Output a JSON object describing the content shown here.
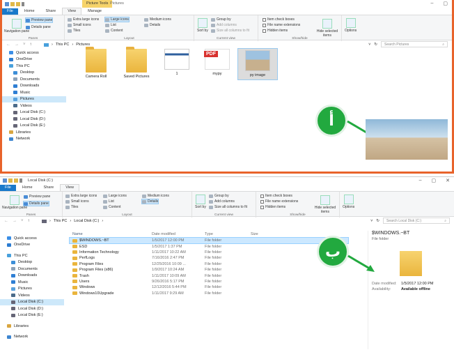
{
  "window1": {
    "context_tab": "Picture Tools",
    "title": "Pictures",
    "tabs": [
      "File",
      "Home",
      "Share",
      "View",
      "Manage"
    ],
    "ribbon": {
      "pane": {
        "navigation_pane": "Navigation pane",
        "preview_pane": "Preview pane",
        "details_pane": "Details pane",
        "label": "Panes"
      },
      "layout": {
        "extra_large": "Extra large icons",
        "large": "Large icons",
        "medium": "Medium icons",
        "small": "Small icons",
        "list": "List",
        "details": "Details",
        "tiles": "Tiles",
        "content": "Content",
        "label": "Layout"
      },
      "current_view": {
        "sort_by": "Sort by",
        "group_by": "Group by",
        "add_columns": "Add columns",
        "size_all": "Size all columns to fit",
        "label": "Current view"
      },
      "show_hide": {
        "item_check": "Item check boxes",
        "file_ext": "File name extensions",
        "hidden": "Hidden items",
        "hide_selected": "Hide selected items",
        "label": "Show/hide"
      },
      "options": "Options"
    },
    "path": [
      "This PC",
      "Pictures"
    ],
    "search_placeholder": "Search Pictures",
    "nav": [
      "Quick access",
      "OneDrive",
      "This PC",
      "Desktop",
      "Documents",
      "Downloads",
      "Music",
      "Pictures",
      "Videos",
      "Local Disk (C:)",
      "Local Disk (D:)",
      "Local Disk (E:)",
      "Libraries",
      "Network"
    ],
    "items": [
      "Camera Roll",
      "Saved Pictures",
      "1",
      "mypy",
      "py image"
    ],
    "pdf_label": "PDF",
    "badge": "أ"
  },
  "window2": {
    "title": "Local Disk (C:)",
    "tabs": [
      "File",
      "Home",
      "Share",
      "View"
    ],
    "path": [
      "This PC",
      "Local Disk (C:)"
    ],
    "search_placeholder": "Search Local Disk (C:)",
    "nav": [
      "Quick access",
      "OneDrive",
      "This PC",
      "Desktop",
      "Documents",
      "Downloads",
      "Music",
      "Pictures",
      "Videos",
      "Local Disk (C:)",
      "Local Disk (D:)",
      "Local Disk (E:)",
      "Libraries",
      "Network"
    ],
    "columns": [
      "Name",
      "Date modified",
      "Type",
      "Size"
    ],
    "rows": [
      {
        "name": "$WINDOWS.~BT",
        "date": "1/5/2017 12:00 PM",
        "type": "File folder"
      },
      {
        "name": "ESD",
        "date": "1/5/2017 1:37 PM",
        "type": "File folder"
      },
      {
        "name": "Information Technology",
        "date": "1/11/2017 10:22 AM",
        "type": "File folder"
      },
      {
        "name": "PerfLogs",
        "date": "7/16/2016 2:47 PM",
        "type": "File folder"
      },
      {
        "name": "Program Files",
        "date": "12/25/2016 10:09 ...",
        "type": "File folder"
      },
      {
        "name": "Program Files (x86)",
        "date": "1/9/2017 10:24 AM",
        "type": "File folder"
      },
      {
        "name": "Trash",
        "date": "1/11/2017 10:09 AM",
        "type": "File folder"
      },
      {
        "name": "Users",
        "date": "9/26/2016 5:17 PM",
        "type": "File folder"
      },
      {
        "name": "Windows",
        "date": "12/12/2016 5:44 PM",
        "type": "File folder"
      },
      {
        "name": "Windows10Upgrade",
        "date": "1/11/2017 9:29 AM",
        "type": "File folder"
      }
    ],
    "preview": {
      "title": "$WINDOWS.~BT",
      "type": "File folder",
      "date_label": "Date modified:",
      "date": "1/5/2017 12:00 PM",
      "avail_label": "Availability:",
      "avail": "Available offline"
    },
    "badge": "ب"
  },
  "colors": {
    "accent": "#1979ca",
    "highlight": "#e8632b",
    "badge": "#22a93f"
  }
}
